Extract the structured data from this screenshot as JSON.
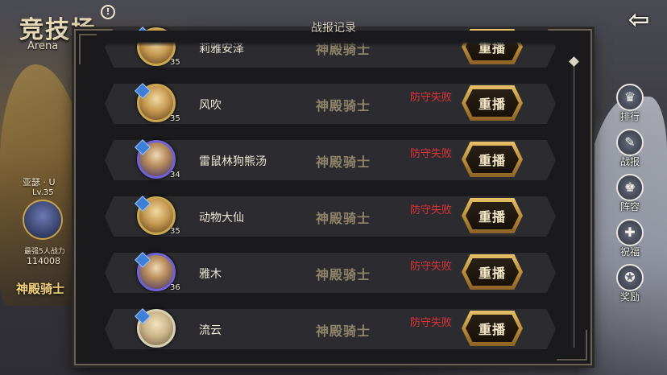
{
  "header": {
    "title": "竞技场",
    "subtitle": "Arena",
    "info_icon": "info-icon",
    "back_icon": "double-arrow-back-icon"
  },
  "player_card": {
    "rank": "亚瑟 · U",
    "level": "Lv.35",
    "power_label": "最强5人战力",
    "power": "114008",
    "tier": "神殿骑士"
  },
  "dialog": {
    "title": "战报记录"
  },
  "records": [
    {
      "name": "莉雅安泽",
      "level": "35",
      "tier": "神殿骑士",
      "result": "",
      "replay": "重播",
      "frame": "gold"
    },
    {
      "name": "风吹",
      "level": "35",
      "tier": "神殿骑士",
      "result": "防守失败",
      "replay": "重播",
      "frame": "gold"
    },
    {
      "name": "雷鼠林狗熊汤",
      "level": "34",
      "tier": "神殿骑士",
      "result": "防守失败",
      "replay": "重播",
      "frame": "blue"
    },
    {
      "name": "动物大仙",
      "level": "35",
      "tier": "神殿骑士",
      "result": "防守失败",
      "replay": "重播",
      "frame": "gold"
    },
    {
      "name": "雅木",
      "level": "36",
      "tier": "神殿骑士",
      "result": "防守失败",
      "replay": "重播",
      "frame": "blue"
    },
    {
      "name": "流云",
      "level": "",
      "tier": "神殿骑士",
      "result": "防守失败",
      "replay": "重播",
      "frame": "white"
    }
  ],
  "side_menu": [
    {
      "label": "排行",
      "icon": "ranking-icon",
      "glyph": "♛"
    },
    {
      "label": "战报",
      "icon": "battle-report-icon",
      "glyph": "✎"
    },
    {
      "label": "阵容",
      "icon": "lineup-icon",
      "glyph": "♚"
    },
    {
      "label": "祝福",
      "icon": "blessing-icon",
      "glyph": "✚"
    },
    {
      "label": "奖励",
      "icon": "reward-icon",
      "glyph": "✪"
    }
  ],
  "colors": {
    "defense_fail": "#e0313a",
    "tier_text": "#8f8469",
    "replay_gold": "#c99b45"
  }
}
